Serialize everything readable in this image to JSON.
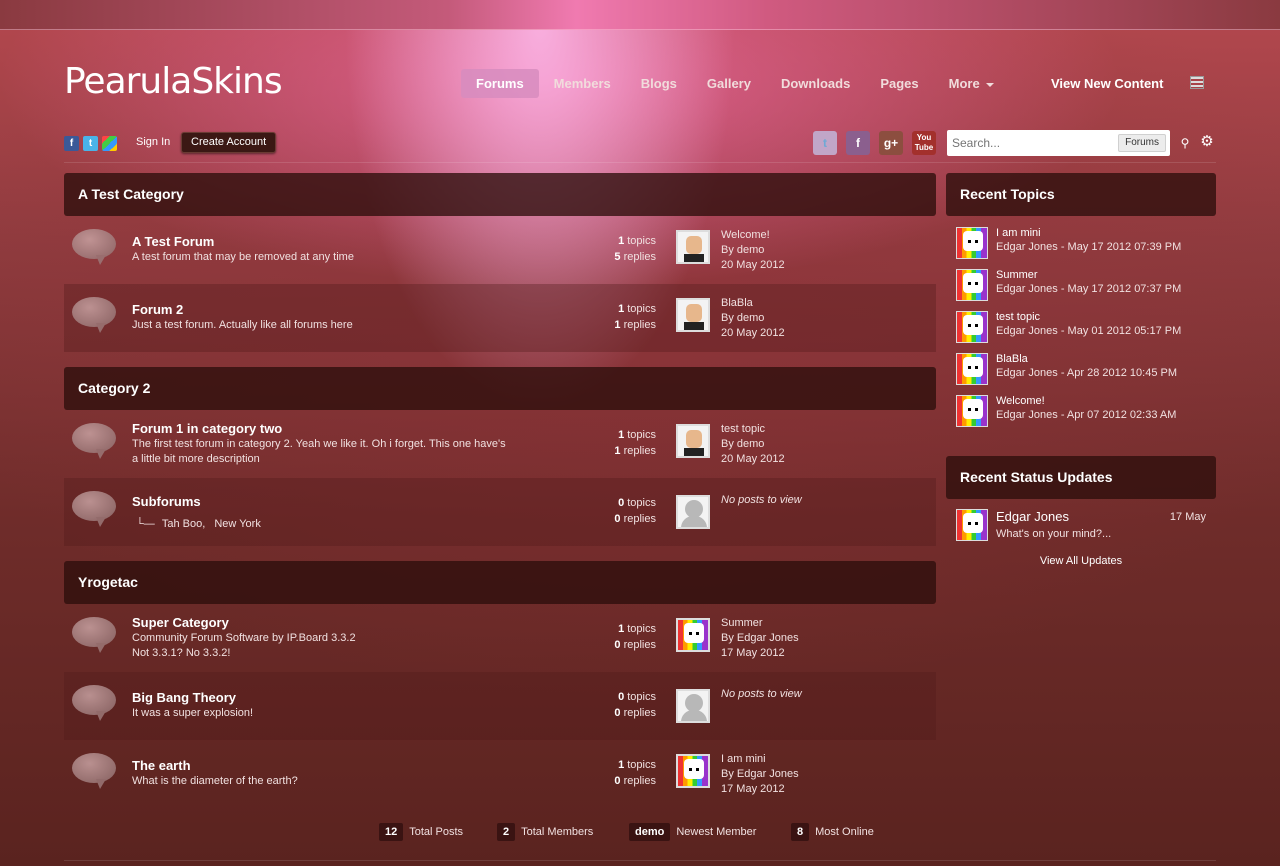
{
  "brand": {
    "logo_text": "PearulaSkins"
  },
  "nav": {
    "items": [
      "Forums",
      "Members",
      "Blogs",
      "Gallery",
      "Downloads",
      "Pages",
      "More"
    ],
    "active": "Forums",
    "view_new": "View New Content"
  },
  "userbar": {
    "sign_in": "Sign In",
    "create_account": "Create Account"
  },
  "search": {
    "placeholder": "Search...",
    "scope": "Forums"
  },
  "categories": [
    {
      "title": "A Test Category",
      "forums": [
        {
          "title": "A Test Forum",
          "desc": "A test forum that may be removed at any time",
          "topics": "1",
          "replies": "5",
          "last_title": "Welcome!",
          "last_by": "By demo",
          "last_date": "20 May 2012"
        },
        {
          "title": "Forum 2",
          "desc": "Just a test forum. Actually like all forums here",
          "topics": "1",
          "replies": "1",
          "last_title": "BlaBla",
          "last_by": "By demo",
          "last_date": "20 May 2012"
        }
      ]
    },
    {
      "title": "Category 2",
      "forums": [
        {
          "title": "Forum 1 in category two",
          "desc": "The first test forum in category 2. Yeah we like it. Oh i forget. This one have's a little bit more description",
          "topics": "1",
          "replies": "1",
          "last_title": "test topic",
          "last_by": "By demo",
          "last_date": "20 May 2012"
        },
        {
          "title": "Subforums",
          "subforums": [
            "Tah Boo,",
            "New York"
          ],
          "topics": "0",
          "replies": "0",
          "no_posts": "No posts to view"
        }
      ]
    },
    {
      "title": "Yrogetac",
      "forums": [
        {
          "title": "Super Category",
          "desc": "Community Forum Software by IP.Board 3.3.2",
          "desc2": "Not 3.3.1? No 3.3.2!",
          "topics": "1",
          "replies": "0",
          "last_title": "Summer",
          "last_by": "By Edgar Jones",
          "last_date": "17 May 2012"
        },
        {
          "title": "Big Bang Theory",
          "desc": "It was a super explosion!",
          "topics": "0",
          "replies": "0",
          "no_posts": "No posts to view"
        },
        {
          "title": "The earth",
          "desc": "What is the diameter of the earth?",
          "topics": "1",
          "replies": "0",
          "last_title": "I am mini",
          "last_by": "By Edgar Jones",
          "last_date": "17 May 2012"
        }
      ]
    }
  ],
  "labels": {
    "topics": "topics",
    "replies": "replies"
  },
  "recent_topics": {
    "title": "Recent Topics",
    "items": [
      {
        "title": "I am mini",
        "meta": "Edgar Jones - May 17 2012 07:39 PM"
      },
      {
        "title": "Summer",
        "meta": "Edgar Jones - May 17 2012 07:37 PM"
      },
      {
        "title": "test topic",
        "meta": "Edgar Jones - May 01 2012 05:17 PM"
      },
      {
        "title": "BlaBla",
        "meta": "Edgar Jones - Apr 28 2012 10:45 PM"
      },
      {
        "title": "Welcome!",
        "meta": "Edgar Jones - Apr 07 2012 02:33 AM"
      }
    ]
  },
  "status_updates": {
    "title": "Recent Status Updates",
    "name": "Edgar Jones",
    "date": "17 May",
    "text": "What's on your mind?...",
    "view_all": "View All Updates"
  },
  "stats": {
    "total_posts": "12",
    "total_posts_label": "Total Posts",
    "total_members": "2",
    "total_members_label": "Total Members",
    "newest": "demo",
    "newest_label": "Newest Member",
    "most_online": "8",
    "most_online_label": "Most Online"
  },
  "colors": {
    "active_nav": "#d78cbe",
    "header_bg": "#2d0e0c",
    "accent_pink": "#f07ab0"
  }
}
